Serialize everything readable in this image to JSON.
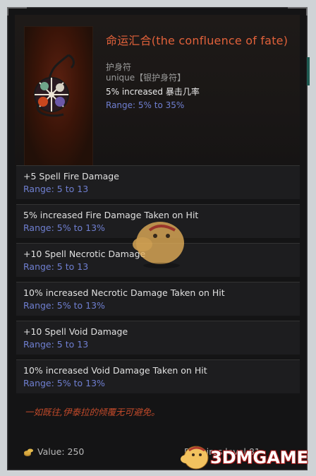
{
  "item": {
    "title": "命运汇合(the confluence of fate)",
    "type": "护身符",
    "rarity": "unique【银护身符】",
    "implicit_text": "5% increased 暴击几率",
    "implicit_range": "Range: 5% to 35%",
    "icon": "amulet-icon"
  },
  "affixes": [
    {
      "name": "+5 Spell Fire Damage",
      "range": "Range: 5 to 13"
    },
    {
      "name": "5% increased Fire Damage Taken on Hit",
      "range": "Range: 5% to 13%"
    },
    {
      "name": "+10 Spell Necrotic Damage",
      "range": "Range: 5 to 13"
    },
    {
      "name": "10% increased Necrotic Damage Taken on Hit",
      "range": "Range: 5% to 13%"
    },
    {
      "name": "+10 Spell Void Damage",
      "range": "Range: 5 to 13"
    },
    {
      "name": "10% increased Void Damage Taken on Hit",
      "range": "Range: 5% to 13%"
    }
  ],
  "flavor": "一如既往,伊泰拉的倾覆无可避免。",
  "footer": {
    "value_label": "Value: 250",
    "requires_label": "Requires level 81",
    "coin_icon": "coin-icon"
  },
  "watermark": {
    "site": "3DMGAME",
    "mascot_icon": "mascot-icon"
  },
  "colors": {
    "title": "#e0613a",
    "range": "#6f7fd1",
    "flavor": "#c14a2a",
    "panel": "#141415"
  }
}
